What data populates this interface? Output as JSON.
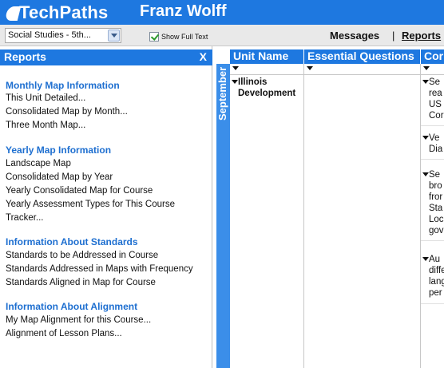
{
  "app": {
    "logo_text": "TechPaths",
    "user_name": "Franz Wolff"
  },
  "toolbar": {
    "course_select": "Social Studies - 5th...",
    "show_full_text_label": "Show Full Text",
    "messages_link": "Messages",
    "separator": "|",
    "reports_link": "Reports"
  },
  "reports_panel": {
    "title": "Reports",
    "close_label": "X",
    "sections": [
      {
        "title": "Monthly Map Information",
        "items": [
          "This Unit Detailed...",
          "Consolidated Map by Month...",
          "Three Month Map..."
        ]
      },
      {
        "title": "Yearly Map Information",
        "items": [
          "Landscape Map",
          "Consolidated Map by Year",
          "Yearly Consolidated Map for Course",
          "Yearly Assessment Types for This Course",
          "Tracker..."
        ]
      },
      {
        "title": "Information About Standards",
        "items": [
          "Standards to be Addressed in Course",
          "Standards Addressed in Maps with Frequency",
          "Standards Aligned in Map for Course"
        ]
      },
      {
        "title": "Information About Alignment",
        "items": [
          "My Map Alignment for this Course...",
          "Alignment of Lesson Plans..."
        ]
      }
    ]
  },
  "grid": {
    "month": "September",
    "columns": {
      "unit_name": "Unit Name",
      "essential_questions": "Essential Questions",
      "content": "Cor"
    },
    "unit_lines": [
      "Illinois",
      "Development"
    ],
    "content_entries": [
      [
        "Se",
        "rea",
        "US",
        "Cor"
      ],
      [
        "Ve",
        "Dia"
      ],
      [
        "Se",
        "bro",
        "fror",
        "Sta",
        "Loc",
        "gov"
      ],
      [
        "Au",
        "diffe",
        "lang",
        "per"
      ]
    ]
  },
  "colors": {
    "header_blue": "#1e78e0",
    "month_blue": "#3b8ee9",
    "section_blue": "#1e6fd0"
  }
}
